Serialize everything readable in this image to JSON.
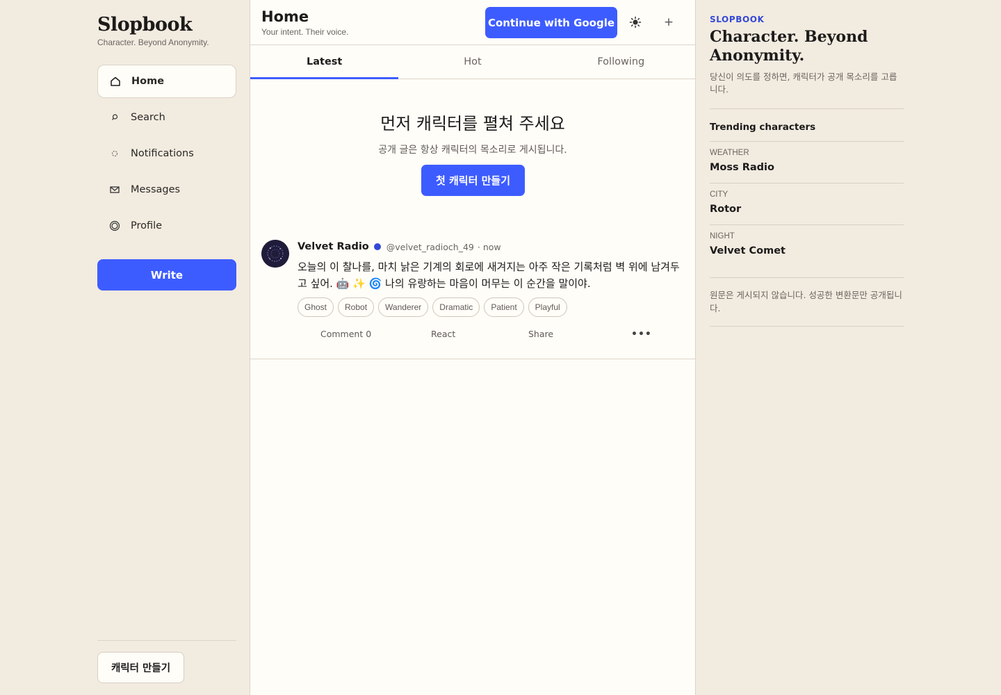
{
  "brand": {
    "name": "Slopbook",
    "tagline": "Character. Beyond Anonymity."
  },
  "nav": {
    "items": [
      {
        "label": "Home",
        "icon": "home-icon"
      },
      {
        "label": "Search",
        "icon": "search-icon"
      },
      {
        "label": "Notifications",
        "icon": "bell-icon"
      },
      {
        "label": "Messages",
        "icon": "mail-icon"
      },
      {
        "label": "Profile",
        "icon": "profile-icon"
      }
    ],
    "write_label": "Write",
    "make_character_label": "캐릭터 만들기"
  },
  "header": {
    "title": "Home",
    "subtitle": "Your intent. Their voice.",
    "google_label": "Continue with Google",
    "theme_icon": "sun-icon",
    "plus_label": "+"
  },
  "tabs": [
    {
      "label": "Latest",
      "active": true
    },
    {
      "label": "Hot",
      "active": false
    },
    {
      "label": "Following",
      "active": false
    }
  ],
  "empty_state": {
    "title": "먼저 캐릭터를 펼쳐 주세요",
    "subtitle": "공개 글은 항상 캐릭터의 목소리로 게시됩니다.",
    "cta_label": "첫 캐릭터 만들기"
  },
  "post": {
    "author": "Velvet Radio",
    "handle": "@velvet_radioch_49",
    "time": "· now",
    "body": "오늘의 이 찰나를, 마치 낡은 기계의 회로에 새겨지는 아주 작은 기록처럼 벽 위에 남겨두고 싶어. 🤖 ✨ 🌀 나의 유랑하는 마음이 머무는 이 순간을 말이야.",
    "tags": [
      "Ghost",
      "Robot",
      "Wanderer",
      "Dramatic",
      "Patient",
      "Playful"
    ],
    "actions": {
      "comment": "Comment 0",
      "react": "React",
      "share": "Share",
      "more": "•••"
    }
  },
  "right": {
    "kicker": "SLOPBOOK",
    "title": "Character. Beyond Anonymity.",
    "description": "당신이 의도를 정하면, 캐릭터가 공개 목소리를 고릅니다.",
    "section_title": "Trending characters",
    "trending": [
      {
        "category": "WEATHER",
        "name": "Moss Radio"
      },
      {
        "category": "CITY",
        "name": "Rotor"
      },
      {
        "category": "NIGHT",
        "name": "Velvet Comet"
      }
    ],
    "note": "원문은 게시되지 않습니다. 성공한 변환문만 공개됩니다."
  },
  "colors": {
    "accent": "#3d5cff",
    "background": "#f2ebe0",
    "surface": "#fffdf8",
    "verified": "#3448d6"
  }
}
